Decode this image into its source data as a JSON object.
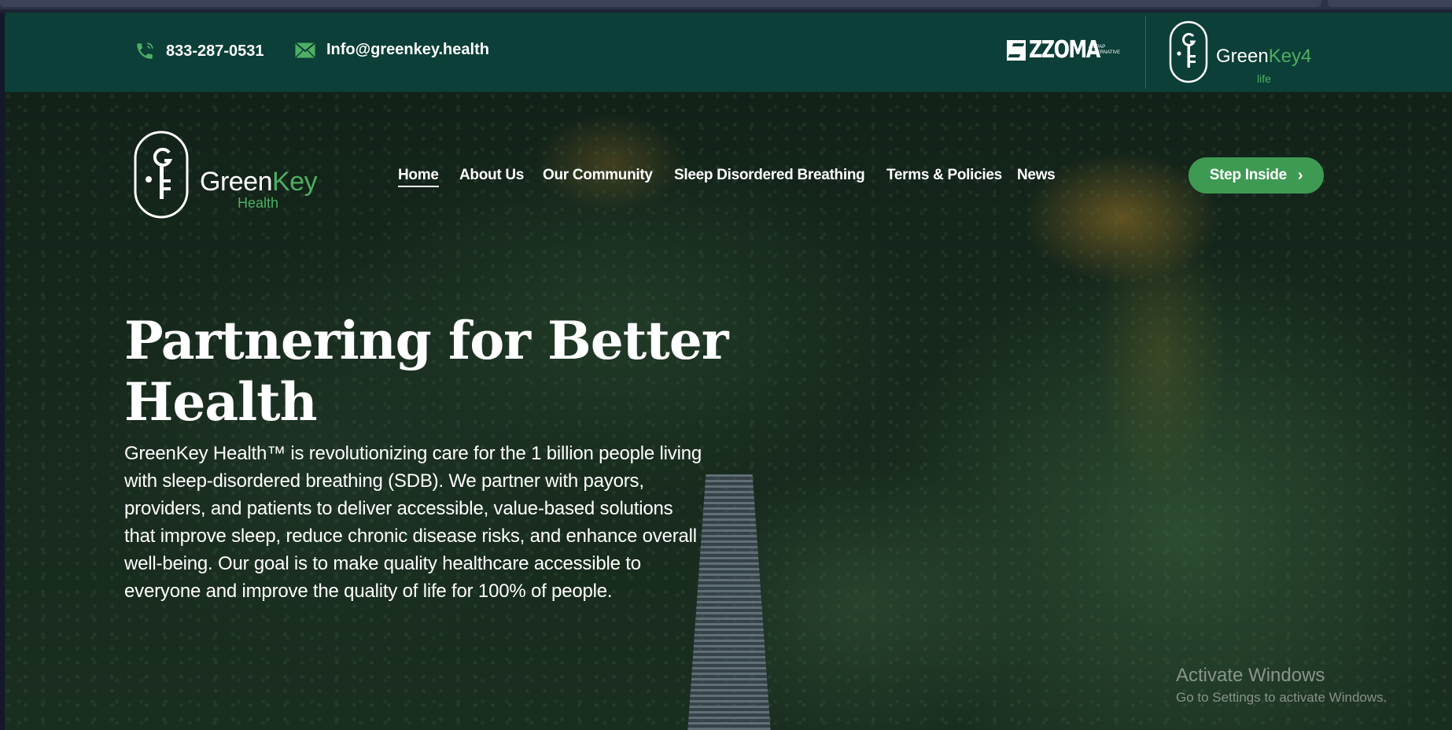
{
  "topbar": {
    "phone": "833-287-0531",
    "email": "Info@greenkey.health",
    "phone_icon": "phone-icon",
    "email_icon": "envelope-icon",
    "partner_logo": {
      "wordmark": "ZZOMA",
      "tagline_1": "A CPAP",
      "tagline_2": "ALTERNATIVE"
    },
    "greenkey4life_logo": {
      "part1": "Green",
      "part2": "Key4",
      "part3": "life"
    }
  },
  "logo": {
    "part1": "Green",
    "part2": "Key",
    "part3": "Health",
    "mark_letter": "G"
  },
  "nav": {
    "items": [
      {
        "label": "Home"
      },
      {
        "label": "About Us"
      },
      {
        "label": "Our Community"
      },
      {
        "label": "Sleep Disordered Breathing"
      },
      {
        "label": "Terms & Policies"
      },
      {
        "label": "News"
      }
    ],
    "cta_label": "Step Inside",
    "cta_icon": "chevron-right-icon"
  },
  "hero": {
    "title": "Partnering for Better Health",
    "body": "GreenKey Health™ is revolutionizing care for the 1 billion people living with sleep-disordered breathing (SDB). We partner with payors, providers, and patients to deliver accessible, value-based solutions that improve sleep, reduce chronic disease risks, and enhance overall well-being. Our goal is to make quality healthcare accessible to everyone and improve the quality of life for 100% of people."
  },
  "watermark": {
    "line1": "Activate Windows",
    "line2": "Go to Settings to activate Windows."
  },
  "colors": {
    "topbar_bg": "#0b3f37",
    "brand_green": "#4fae63",
    "cta_bg": "#3e9a52"
  }
}
